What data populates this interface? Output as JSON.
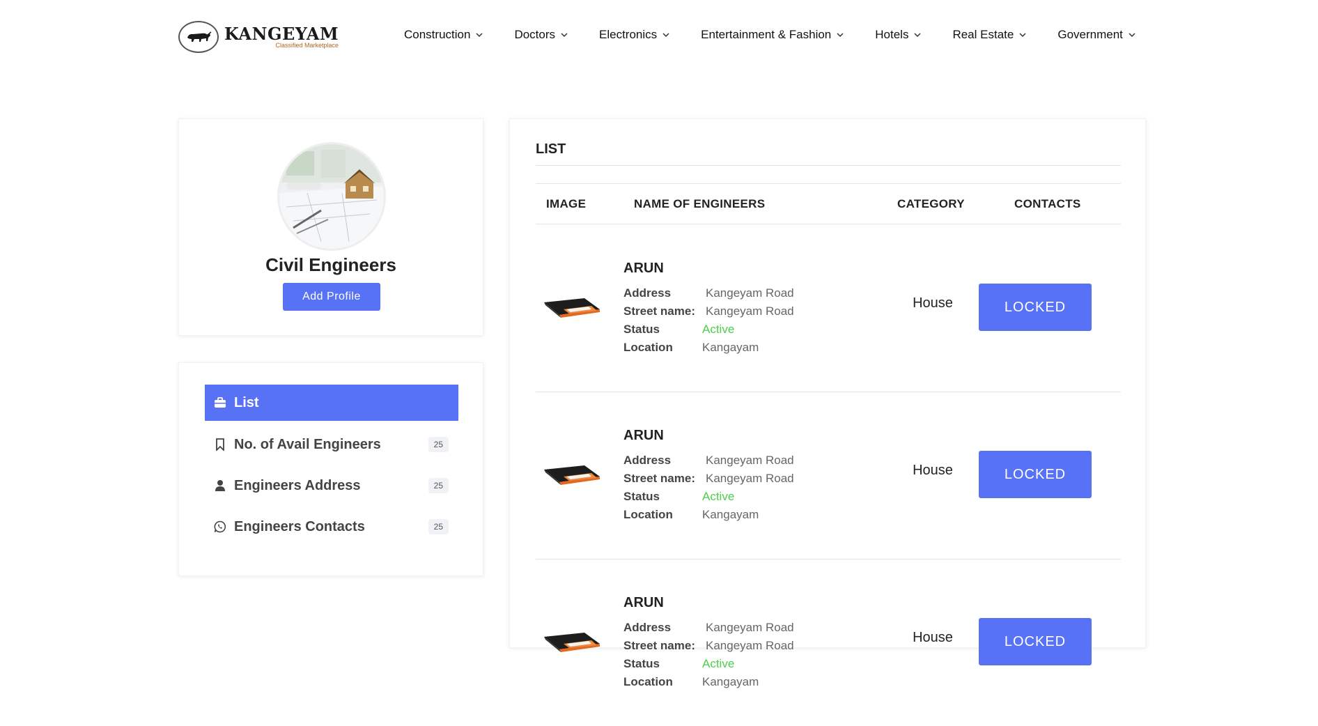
{
  "brand": {
    "name": "KANGEYAM",
    "tagline": "Classified Marketplace"
  },
  "nav": {
    "items": [
      {
        "label": "Construction"
      },
      {
        "label": "Doctors"
      },
      {
        "label": "Electronics"
      },
      {
        "label": "Entertainment & Fashion"
      },
      {
        "label": "Hotels"
      },
      {
        "label": "Real Estate"
      },
      {
        "label": "Government"
      }
    ]
  },
  "profile": {
    "name": "Civil Engineers",
    "add_button": "Add Profile"
  },
  "menu": {
    "items": [
      {
        "label": "List",
        "icon": "briefcase-icon",
        "active": true
      },
      {
        "label": "No. of Avail Engineers",
        "icon": "bookmark-icon",
        "badge": "25"
      },
      {
        "label": "Engineers Address",
        "icon": "user-icon",
        "badge": "25"
      },
      {
        "label": "Engineers Contacts",
        "icon": "whatsapp-icon",
        "badge": "25"
      }
    ]
  },
  "list": {
    "title": "LIST",
    "headers": {
      "image": "IMAGE",
      "name": "NAME OF ENGINEERS",
      "category": "CATEGORY",
      "contacts": "CONTACTS"
    },
    "field_labels": {
      "address": "Address",
      "street": "Street name:",
      "status": "Status",
      "location": "Location"
    },
    "rows": [
      {
        "name": "ARUN",
        "address": "Kangeyam Road",
        "street": "Kangeyam Road",
        "status": "Active",
        "location": "Kangayam",
        "category": "House",
        "action": "LOCKED"
      },
      {
        "name": "ARUN",
        "address": "Kangeyam Road",
        "street": "Kangeyam Road",
        "status": "Active",
        "location": "Kangayam",
        "category": "House",
        "action": "LOCKED"
      },
      {
        "name": "ARUN",
        "address": "Kangeyam Road",
        "street": "Kangeyam Road",
        "status": "Active",
        "location": "Kangayam",
        "category": "House",
        "action": "LOCKED"
      }
    ]
  },
  "colors": {
    "accent": "#5872f5",
    "status_active": "#4ccf4c",
    "brand_sub": "#b5651d"
  }
}
